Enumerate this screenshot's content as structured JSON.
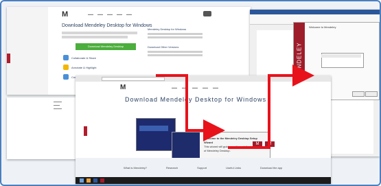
{
  "background_screenshot": {
    "page_heading": "Download Mendeley Desktop for Windows",
    "download_button_label": "Download Mendeley Desktop",
    "features": [
      {
        "label": "Collaborate & Share",
        "icon": "group-icon",
        "color": "#4a90d9"
      },
      {
        "label": "Annotate & Highlight",
        "icon": "pen-icon",
        "color": "#f2b705"
      },
      {
        "label": "Create citations",
        "icon": "quote-icon",
        "color": "#4a90d9"
      }
    ],
    "side_headings": [
      "Mendeley Desktop for Windows",
      "Download Other Versions"
    ]
  },
  "browser_screenshot": {
    "page_heading": "Download Mendeley Desktop for Windows",
    "installer_dialog_title": "Welcome to the Mendeley Desktop Setup Wizard",
    "installer_body": "This wizard will guide you through the installation of Mendeley Desktop.",
    "footer_links": [
      "What is Mendeley?",
      "Research",
      "Support",
      "Useful Links",
      "Download the app"
    ]
  },
  "word_screenshot": {
    "dialog_title": "Welcome to Mendeley",
    "banner_text": "MENDELEY"
  },
  "colors": {
    "arrow": "#e8121b",
    "brand_red": "#9e1d2b",
    "frame_border": "#4a7fc1"
  }
}
